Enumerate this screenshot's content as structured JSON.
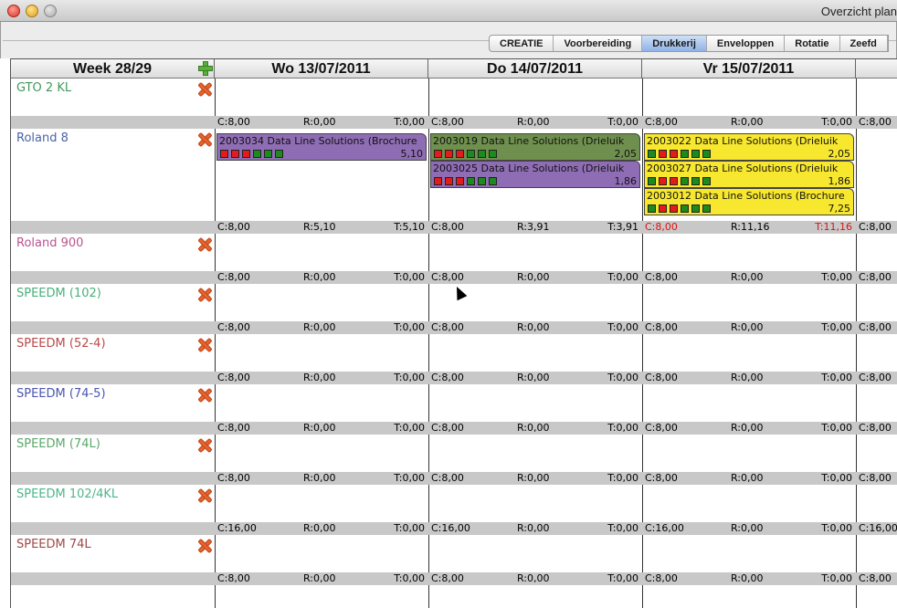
{
  "window": {
    "title": "Overzicht plan"
  },
  "tabs": [
    {
      "label": "CREATIE",
      "active": false
    },
    {
      "label": "Voorbereiding",
      "active": false
    },
    {
      "label": "Drukkerij",
      "active": true
    },
    {
      "label": "Enveloppen",
      "active": false
    },
    {
      "label": "Rotatie",
      "active": false
    },
    {
      "label": "Zeefd",
      "active": false
    }
  ],
  "header": {
    "week": "Week 28/29",
    "days": [
      "Wo 13/07/2011",
      "Do 14/07/2011",
      "Vr 15/07/2011"
    ]
  },
  "colors": {
    "purple_job": "#8f6db4",
    "olive_job": "#6f8f4e",
    "yellow_job": "#f7e72e",
    "over_capacity": "#e01010"
  },
  "machines": [
    {
      "name": "GTO 2 KL",
      "color": "#3f9a5a",
      "summaries": [
        {
          "c": "C:8,00",
          "r": "R:0,00",
          "t": "T:0,00",
          "over": false
        },
        {
          "c": "C:8,00",
          "r": "R:0,00",
          "t": "T:0,00",
          "over": false
        },
        {
          "c": "C:8,00",
          "r": "R:0,00",
          "t": "T:0,00",
          "over": false
        },
        {
          "c": "C:8,00"
        }
      ]
    },
    {
      "name": "Roland 8",
      "color": "#4a63a8",
      "summaries": [
        {
          "c": "C:8,00",
          "r": "R:5,10",
          "t": "T:5,10",
          "over": false
        },
        {
          "c": "C:8,00",
          "r": "R:3,91",
          "t": "T:3,91",
          "over": false
        },
        {
          "c": "C:8,00",
          "r": "R:11,16",
          "t": "T:11,16",
          "over": true
        },
        {
          "c": "C:8,00"
        }
      ]
    },
    {
      "name": "Roland 900",
      "color": "#b9548e",
      "summaries": [
        {
          "c": "C:8,00",
          "r": "R:0,00",
          "t": "T:0,00",
          "over": false
        },
        {
          "c": "C:8,00",
          "r": "R:0,00",
          "t": "T:0,00",
          "over": false
        },
        {
          "c": "C:8,00",
          "r": "R:0,00",
          "t": "T:0,00",
          "over": false
        },
        {
          "c": "C:8,00"
        }
      ]
    },
    {
      "name": "SPEEDM (102)",
      "color": "#48b07a",
      "summaries": [
        {
          "c": "C:8,00",
          "r": "R:0,00",
          "t": "T:0,00",
          "over": false
        },
        {
          "c": "C:8,00",
          "r": "R:0,00",
          "t": "T:0,00",
          "over": false
        },
        {
          "c": "C:8,00",
          "r": "R:0,00",
          "t": "T:0,00",
          "over": false
        },
        {
          "c": "C:8,00"
        }
      ]
    },
    {
      "name": "SPEEDM (52-4)",
      "color": "#b94a4a",
      "summaries": [
        {
          "c": "C:8,00",
          "r": "R:0,00",
          "t": "T:0,00",
          "over": false
        },
        {
          "c": "C:8,00",
          "r": "R:0,00",
          "t": "T:0,00",
          "over": false
        },
        {
          "c": "C:8,00",
          "r": "R:0,00",
          "t": "T:0,00",
          "over": false
        },
        {
          "c": "C:8,00"
        }
      ]
    },
    {
      "name": "SPEEDM (74-5)",
      "color": "#4a55b0",
      "summaries": [
        {
          "c": "C:8,00",
          "r": "R:0,00",
          "t": "T:0,00",
          "over": false
        },
        {
          "c": "C:8,00",
          "r": "R:0,00",
          "t": "T:0,00",
          "over": false
        },
        {
          "c": "C:8,00",
          "r": "R:0,00",
          "t": "T:0,00",
          "over": false
        },
        {
          "c": "C:8,00"
        }
      ]
    },
    {
      "name": "SPEEDM (74L)",
      "color": "#5aa86a",
      "summaries": [
        {
          "c": "C:8,00",
          "r": "R:0,00",
          "t": "T:0,00",
          "over": false
        },
        {
          "c": "C:8,00",
          "r": "R:0,00",
          "t": "T:0,00",
          "over": false
        },
        {
          "c": "C:8,00",
          "r": "R:0,00",
          "t": "T:0,00",
          "over": false
        },
        {
          "c": "C:8,00"
        }
      ]
    },
    {
      "name": "SPEEDM 102/4KL",
      "color": "#4cb68a",
      "summaries": [
        {
          "c": "C:16,00",
          "r": "R:0,00",
          "t": "T:0,00",
          "over": false
        },
        {
          "c": "C:16,00",
          "r": "R:0,00",
          "t": "T:0,00",
          "over": false
        },
        {
          "c": "C:16,00",
          "r": "R:0,00",
          "t": "T:0,00",
          "over": false
        },
        {
          "c": "C:16,00"
        }
      ]
    },
    {
      "name": "SPEEDM 74L",
      "color": "#a04848",
      "summaries": [
        {
          "c": "C:8,00",
          "r": "R:0,00",
          "t": "T:0,00",
          "over": false
        },
        {
          "c": "C:8,00",
          "r": "R:0,00",
          "t": "T:0,00",
          "over": false
        },
        {
          "c": "C:8,00",
          "r": "R:0,00",
          "t": "T:0,00",
          "over": false
        },
        {
          "c": "C:8,00"
        }
      ]
    }
  ],
  "jobs": [
    {
      "machine": 1,
      "day": 0,
      "slot": 0,
      "title": "2003034 Data Line Solutions (Brochure",
      "hours": "5,10",
      "color": "#8f6db4",
      "squares": [
        "red",
        "red",
        "red",
        "green",
        "green",
        "green"
      ]
    },
    {
      "machine": 1,
      "day": 1,
      "slot": 0,
      "title": "2003019 Data Line Solutions (Drieluik",
      "hours": "2,05",
      "color": "#6f8f4e",
      "squares": [
        "red",
        "red",
        "red",
        "green",
        "green",
        "green"
      ]
    },
    {
      "machine": 1,
      "day": 1,
      "slot": 1,
      "title": "2003025 Data Line Solutions (Drieluik",
      "hours": "1,86",
      "color": "#8f6db4",
      "squares": [
        "red",
        "red",
        "red",
        "green",
        "green",
        "green"
      ]
    },
    {
      "machine": 1,
      "day": 2,
      "slot": 0,
      "title": "2003022 Data Line Solutions (Drieluik",
      "hours": "2,05",
      "color": "#f7e72e",
      "squares": [
        "green",
        "red",
        "red",
        "green",
        "green",
        "green"
      ]
    },
    {
      "machine": 1,
      "day": 2,
      "slot": 1,
      "title": "2003027 Data Line Solutions (Drieluik",
      "hours": "1,86",
      "color": "#f7e72e",
      "squares": [
        "green",
        "red",
        "red",
        "green",
        "green",
        "green"
      ]
    },
    {
      "machine": 1,
      "day": 2,
      "slot": 2,
      "title": "2003012 Data Line Solutions (Brochure",
      "hours": "7,25",
      "color": "#f7e72e",
      "squares": [
        "green",
        "red",
        "red",
        "green",
        "green",
        "green"
      ]
    }
  ]
}
